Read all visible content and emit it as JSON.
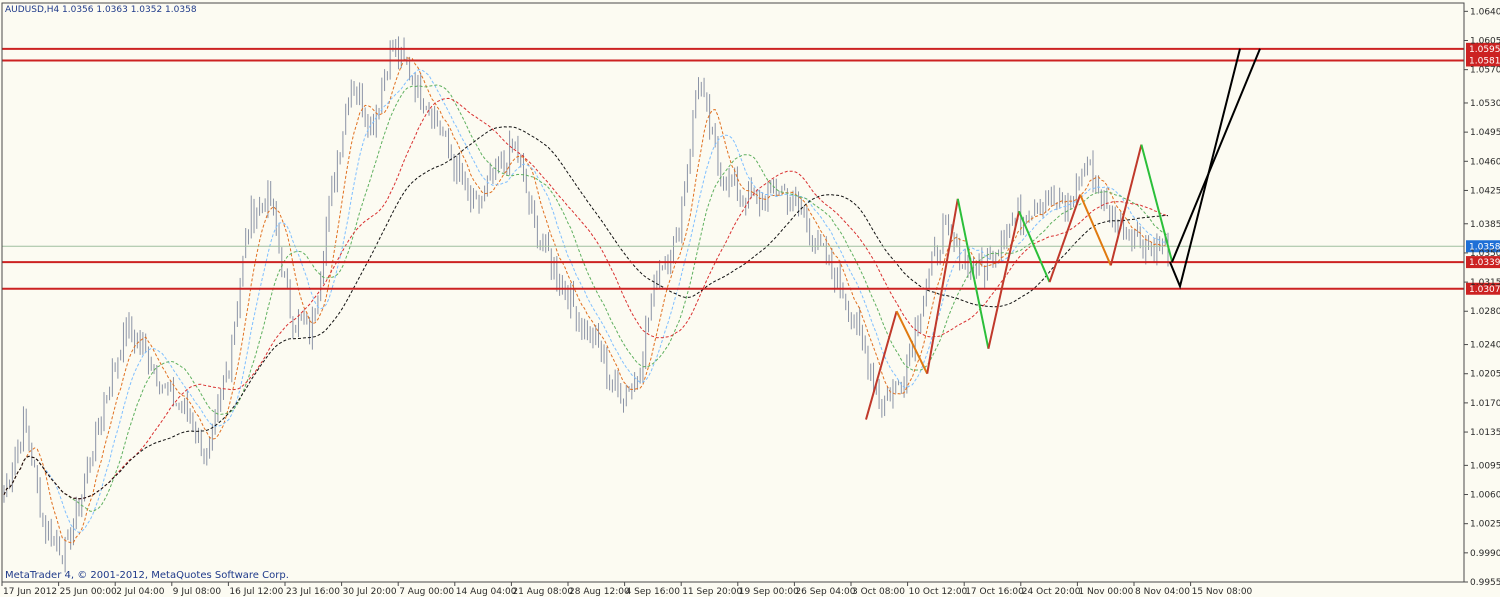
{
  "header": {
    "symbol": "AUDUSD,H4",
    "ohlc": "1.0356 1.0363 1.0352 1.0358"
  },
  "copyright": "MetaTrader 4, © 2001-2012, MetaQuotes Software Corp.",
  "colors": {
    "background": "#fcfbf2",
    "candles": "#8b93a6",
    "axis": "#4a4a4a",
    "resistance": "#cc2222",
    "current_price": "#9fbfa0",
    "current_price_tag": "#1e6fd6",
    "projection": "#000000",
    "zigzag_up": "#c0392b",
    "zigzag_down": "#2bbf3a",
    "zigzag_orange": "#e07a10"
  },
  "chart_data": {
    "type": "line",
    "title": "AUDUSD,H4",
    "ylim": [
      0.9955,
      1.065
    ],
    "grid": false,
    "y_ticks": [
      "1.0640",
      "1.0605",
      "1.0570",
      "1.0530",
      "1.0495",
      "1.0460",
      "1.0425",
      "1.0385",
      "1.0350",
      "1.0315",
      "1.0280",
      "1.0240",
      "1.0205",
      "1.0170",
      "1.0135",
      "1.0095",
      "1.0060",
      "1.0025",
      "0.9990",
      "0.9955"
    ],
    "x_ticks": [
      "17 Jun 2012",
      "25 Jun 00:00",
      "2 Jul 04:00",
      "9 Jul 08:00",
      "16 Jul 12:00",
      "23 Jul 16:00",
      "30 Jul 20:00",
      "7 Aug 00:00",
      "14 Aug 04:00",
      "21 Aug 08:00",
      "28 Aug 12:00",
      "4 Sep 16:00",
      "11 Sep 20:00",
      "19 Sep 00:00",
      "26 Sep 04:00",
      "3 Oct 08:00",
      "10 Oct 12:00",
      "17 Oct 16:00",
      "24 Oct 20:00",
      "1 Nov 00:00",
      "8 Nov 04:00",
      "15 Nov 08:00"
    ],
    "price_close_path": [
      1.006,
      1.015,
      1.002,
      0.999,
      1.008,
      1.018,
      1.026,
      1.023,
      1.018,
      1.016,
      1.01,
      1.022,
      1.039,
      1.042,
      1.028,
      1.025,
      1.042,
      1.056,
      1.05,
      1.06,
      1.056,
      1.052,
      1.046,
      1.04,
      1.044,
      1.048,
      1.038,
      1.033,
      1.028,
      1.024,
      1.018,
      1.02,
      1.033,
      1.037,
      1.056,
      1.045,
      1.042,
      1.041,
      1.043,
      1.04,
      1.035,
      1.031,
      1.024,
      1.017,
      1.02,
      1.03,
      1.038,
      1.034,
      1.033,
      1.038,
      1.04,
      1.042,
      1.04,
      1.046,
      1.04,
      1.038,
      1.036,
      1.0358
    ],
    "horizontal_levels": [
      {
        "value": 1.0595,
        "label": "1.0595"
      },
      {
        "value": 1.0581,
        "label": "1.0581"
      },
      {
        "value": 1.0339,
        "label": "1.0339"
      },
      {
        "value": 1.0307,
        "label": "1.0307"
      }
    ],
    "current_price": {
      "value": 1.0358,
      "label": "1.0358"
    },
    "projection_path": [
      1.0339,
      1.031,
      1.0595
    ],
    "projection_path_2": [
      1.0339,
      1.0595
    ],
    "zigzag": [
      1.015,
      1.028,
      1.0205,
      1.0415,
      1.0235,
      1.04,
      1.0315,
      1.042,
      1.0335,
      1.048,
      1.034
    ]
  }
}
